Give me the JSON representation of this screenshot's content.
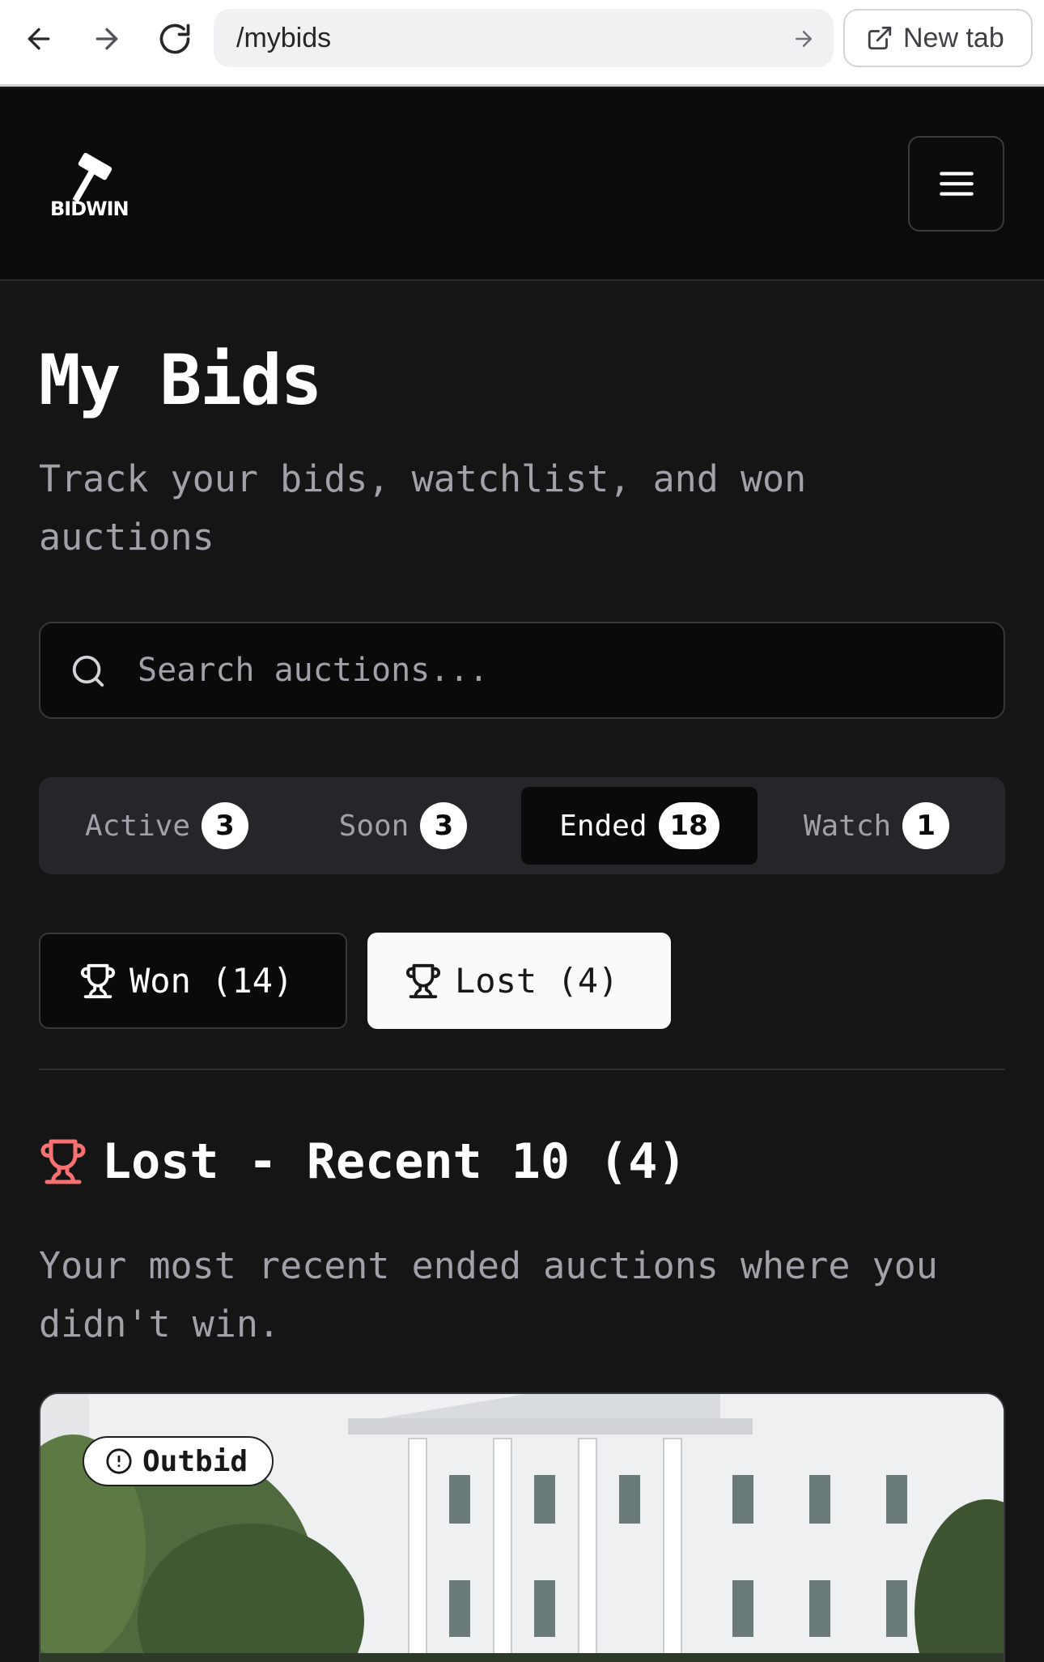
{
  "browser": {
    "url": "/mybids",
    "new_tab_label": "New tab"
  },
  "header": {
    "logo_text": "BIDWIN"
  },
  "page": {
    "title": "My Bids",
    "subtitle": "Track your bids, watchlist, and won auctions"
  },
  "search": {
    "placeholder": "Search auctions..."
  },
  "tabs": [
    {
      "label": "Active",
      "count": "3",
      "active": false
    },
    {
      "label": "Soon",
      "count": "3",
      "active": false
    },
    {
      "label": "Ended",
      "count": "18",
      "active": true
    },
    {
      "label": "Watch",
      "count": "1",
      "active": false
    }
  ],
  "filters": {
    "won_label": "Won (14)",
    "lost_label": "Lost (4)",
    "selected": "lost"
  },
  "section": {
    "title": "Lost - Recent 10 (4)",
    "description": "Your most recent ended auctions where you didn't win.",
    "icon": "trophy-icon",
    "icon_color": "#f87171"
  },
  "cards": [
    {
      "status": "Outbid",
      "status_icon": "alert-circle-icon"
    }
  ],
  "colors": {
    "background": "#151516",
    "header": "#0b0b0c",
    "accent_red": "#f87171"
  }
}
